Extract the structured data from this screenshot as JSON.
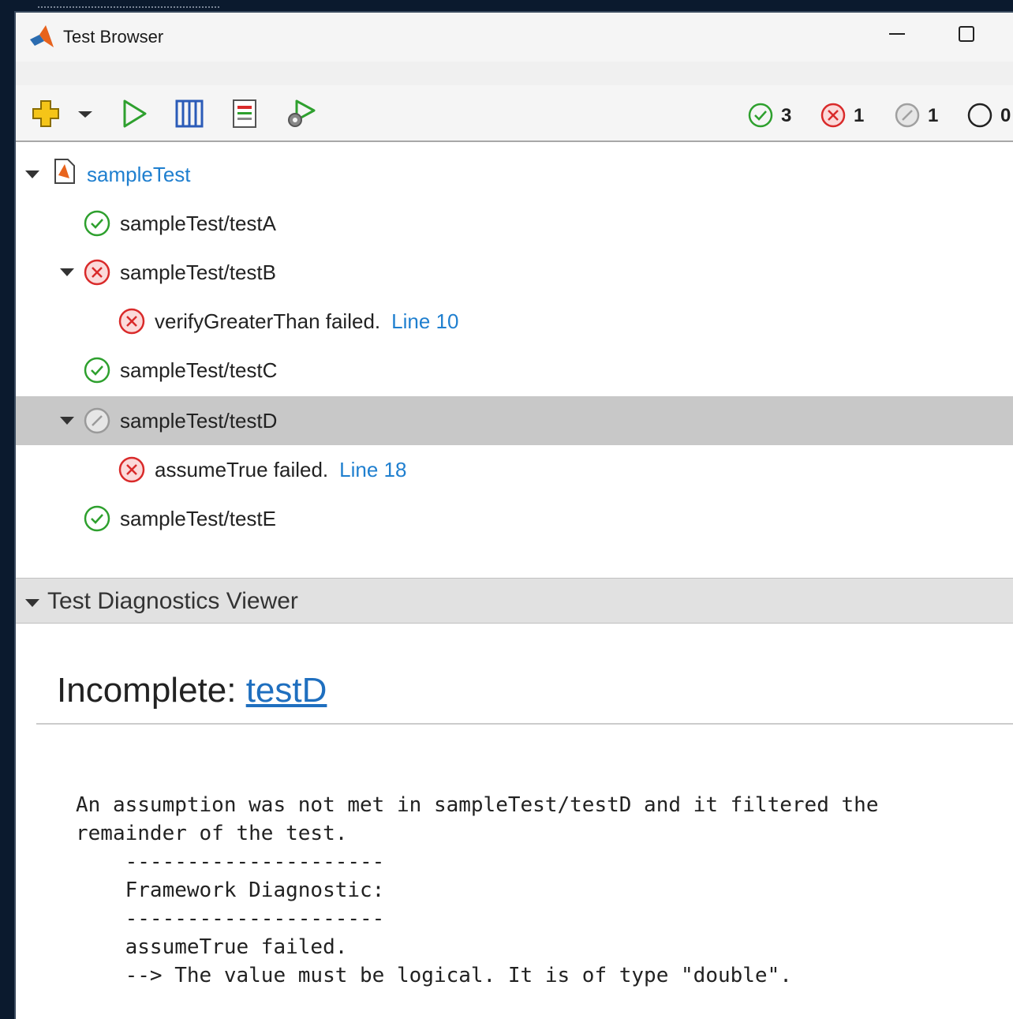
{
  "window": {
    "title": "Test Browser"
  },
  "toolbar": {
    "summary": {
      "passed": "3",
      "failed": "1",
      "incomplete": "1",
      "not_run": "0"
    }
  },
  "tree": {
    "root": {
      "label": "sampleTest"
    },
    "rows": [
      {
        "label": "sampleTest/testA",
        "status": "passed"
      },
      {
        "label": "sampleTest/testB",
        "status": "failed"
      },
      {
        "label": "verifyGreaterThan failed.",
        "link": "Line 10",
        "status": "failed"
      },
      {
        "label": "sampleTest/testC",
        "status": "passed"
      },
      {
        "label": "sampleTest/testD",
        "status": "incomplete"
      },
      {
        "label": "assumeTrue failed.",
        "link": "Line 18",
        "status": "failed"
      },
      {
        "label": "sampleTest/testE",
        "status": "passed"
      }
    ]
  },
  "diagnostics": {
    "panel_title": "Test Diagnostics Viewer",
    "heading_prefix": "Incomplete: ",
    "heading_link": "testD",
    "message": "An assumption was not met in sampleTest/testD and it filtered the\nremainder of the test.\n    ---------------------\n    Framework Diagnostic:\n    ---------------------\n    assumeTrue failed.\n    --> The value must be logical. It is of type \"double\"."
  },
  "colors": {
    "pass": "#2ea02e",
    "fail": "#d92a2a",
    "incomplete": "#a0a0a0",
    "link": "#1f7fcf",
    "selected_row": "#c8c8c8"
  }
}
